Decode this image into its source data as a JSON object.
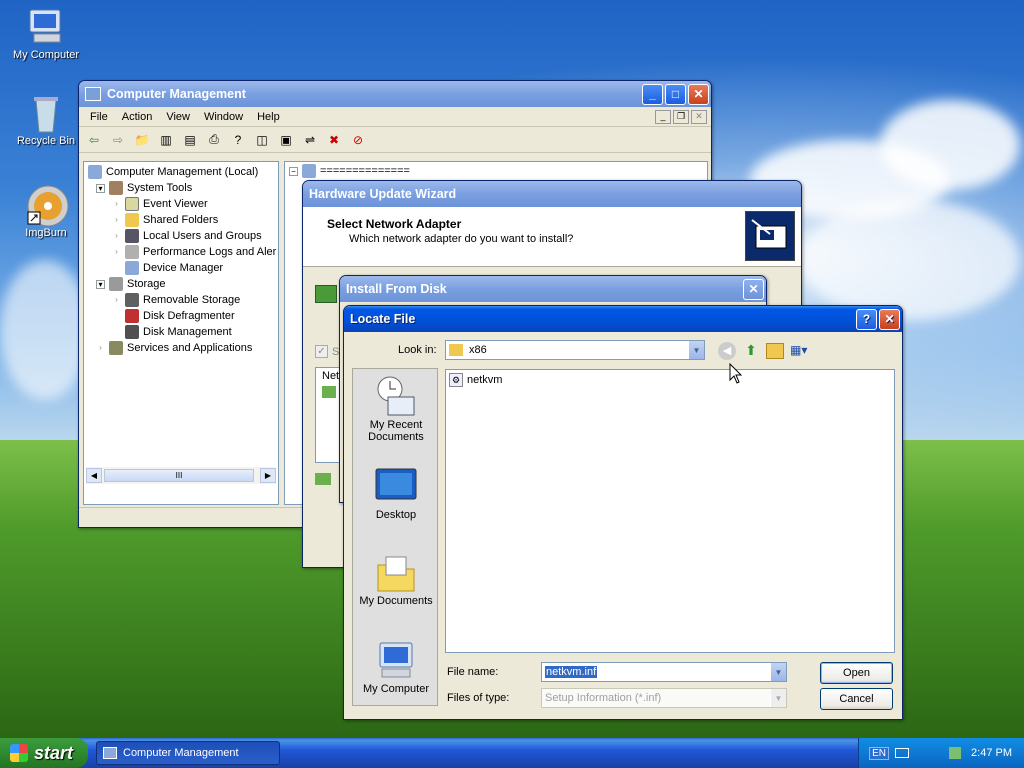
{
  "desktop": {
    "icons": [
      {
        "label": "My Computer"
      },
      {
        "label": "Recycle Bin"
      },
      {
        "label": "ImgBurn"
      }
    ]
  },
  "computer_management": {
    "title": "Computer Management",
    "menu": [
      "File",
      "Action",
      "View",
      "Window",
      "Help"
    ],
    "tree": [
      {
        "label": "Computer Management (Local)",
        "level": 0
      },
      {
        "label": "System Tools",
        "level": 1
      },
      {
        "label": "Event Viewer",
        "level": 2
      },
      {
        "label": "Shared Folders",
        "level": 2
      },
      {
        "label": "Local Users and Groups",
        "level": 2
      },
      {
        "label": "Performance Logs and Aler",
        "level": 2
      },
      {
        "label": "Device Manager",
        "level": 2
      },
      {
        "label": "Storage",
        "level": 1
      },
      {
        "label": "Removable Storage",
        "level": 2
      },
      {
        "label": "Disk Defragmenter",
        "level": 2
      },
      {
        "label": "Disk Management",
        "level": 2
      },
      {
        "label": "Services and Applications",
        "level": 1
      }
    ],
    "right_root": "==============",
    "scroll_grip": "III"
  },
  "hardware_wizard": {
    "title": "Hardware Update Wizard",
    "heading": "Select Network Adapter",
    "subheading": "Which network adapter do you want to install?",
    "partial_checkbox": "S",
    "partial_list": "Net"
  },
  "install_from_disk": {
    "title": "Install From Disk"
  },
  "locate_file": {
    "title": "Locate File",
    "look_in_label": "Look in:",
    "look_in_value": "x86",
    "files": [
      {
        "name": "netkvm",
        "icon": "setup-info-icon"
      }
    ],
    "places": [
      {
        "label": "My Recent Documents",
        "icon": "recent-documents-icon"
      },
      {
        "label": "Desktop",
        "icon": "desktop-icon"
      },
      {
        "label": "My Documents",
        "icon": "my-documents-icon"
      },
      {
        "label": "My Computer",
        "icon": "my-computer-icon"
      }
    ],
    "file_name_label": "File name:",
    "file_name_value": "netkvm.inf",
    "file_type_label": "Files of type:",
    "file_type_value": "Setup Information (*.inf)",
    "open_label": "Open",
    "cancel_label": "Cancel"
  },
  "taskbar": {
    "start_label": "start",
    "task_label": "Computer Management",
    "lang": "EN",
    "clock": "2:47 PM"
  }
}
